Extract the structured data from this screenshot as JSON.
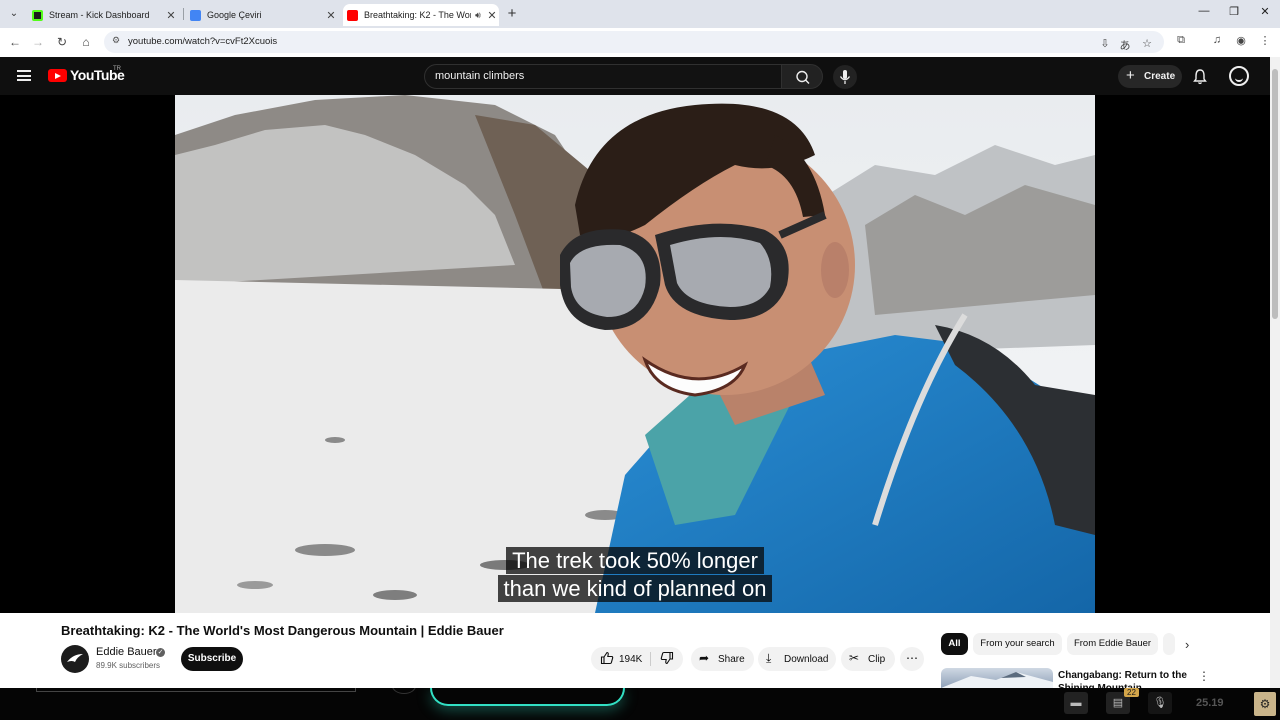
{
  "browser": {
    "tabs": [
      {
        "title": "Stream - Kick Dashboard",
        "favicon_color": "#53fc18"
      },
      {
        "title": "Google Çeviri",
        "favicon_color": "#4285f4"
      },
      {
        "title": "Breathtaking: K2 - The World's Most Dangerous Mountain | Eddie Bauer",
        "favicon_color": "#ff0000",
        "audio_icon": "speaker-icon"
      }
    ],
    "newtab_glyph": "+",
    "url": "youtube.com/watch?v=cvFt2Xcuois",
    "window_controls": [
      "—",
      "❐",
      "✕"
    ]
  },
  "youtube": {
    "logo_text": "YouTube",
    "region_code": "TR",
    "search_query": "mountain climbers",
    "create_label": "Create"
  },
  "video": {
    "caption_line1": "The trek took 50% longer",
    "caption_line2": "than we kind of planned on",
    "title": "Breathtaking: K2 - The World's Most Dangerous Mountain | Eddie Bauer",
    "channel": "Eddie Bauer",
    "subscribers": "89.9K subscribers",
    "subscribe_label": "Subscribe",
    "likes": "194K",
    "share_label": "Share",
    "download_label": "Download",
    "clip_label": "Clip"
  },
  "chips": [
    "All",
    "From your search",
    "From Eddie Bauer"
  ],
  "recommendation": {
    "title": "Changabang: Return to the Shining Mountain"
  },
  "taskbar": {
    "time_fragment": "25.19",
    "badge": "22"
  }
}
